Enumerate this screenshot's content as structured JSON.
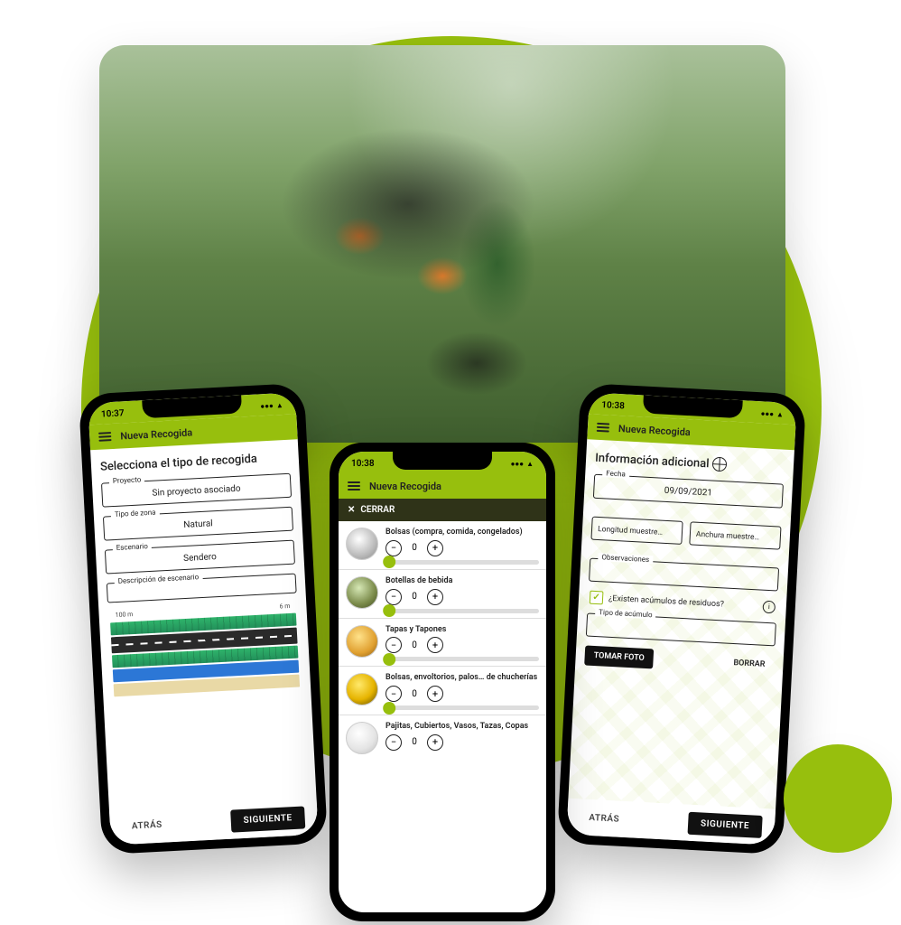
{
  "phone1": {
    "time": "10:37",
    "header": "Nueva Recogida",
    "title": "Selecciona el tipo de recogida",
    "fields": {
      "proyecto": {
        "label": "Proyecto",
        "value": "Sin proyecto asociado"
      },
      "tipo_zona": {
        "label": "Tipo de zona",
        "value": "Natural"
      },
      "escenario": {
        "label": "Escenario",
        "value": "Sendero"
      },
      "descripcion": {
        "label": "Descripción de escenario",
        "value": ""
      }
    },
    "diagram": {
      "width": "100 m",
      "height": "6 m"
    },
    "footer": {
      "back": "ATRÁS",
      "next": "SIGUIENTE"
    }
  },
  "phone2": {
    "time": "10:38",
    "header": "Nueva Recogida",
    "overlay_close": "CERRAR",
    "items": [
      {
        "title": "Bolsas (compra, comida, congelados)",
        "count": "0"
      },
      {
        "title": "Botellas de bebida",
        "count": "0"
      },
      {
        "title": "Tapas y Tapones",
        "count": "0"
      },
      {
        "title": "Bolsas, envoltorios, palos… de chucherías",
        "count": "0"
      },
      {
        "title": "Pajitas, Cubiertos, Vasos, Tazas, Copas",
        "count": "0"
      }
    ]
  },
  "phone3": {
    "time": "10:38",
    "header": "Nueva Recogida",
    "title": "Información adicional",
    "fields": {
      "fecha": {
        "label": "Fecha",
        "value": "09/09/2021"
      },
      "longitud": {
        "label": "Longitud muestre…",
        "value": ""
      },
      "anchura": {
        "label": "Anchura muestre…",
        "value": ""
      },
      "observaciones": {
        "label": "Observaciones",
        "value": ""
      },
      "tipo_acumulo": {
        "label": "Tipo de acúmulo",
        "value": ""
      }
    },
    "checkbox_label": "¿Existen acúmulos de residuos?",
    "buttons": {
      "foto": "TOMAR FOTO",
      "borrar": "BORRAR"
    },
    "footer": {
      "back": "ATRÁS",
      "next": "SIGUIENTE"
    }
  }
}
